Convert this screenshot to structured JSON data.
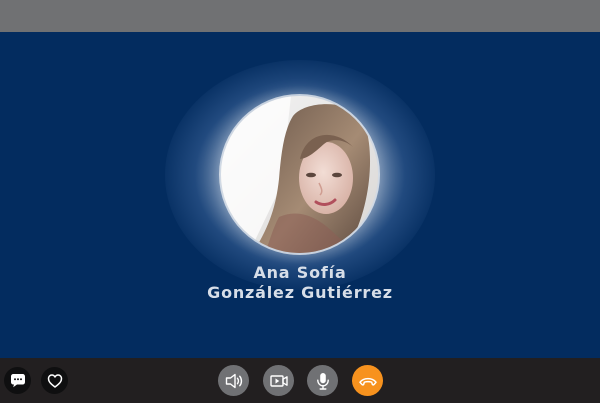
{
  "caller": {
    "name_line1": "Ana Sofía",
    "name_line2": "González Gutiérrez"
  },
  "controls": {
    "left": [
      {
        "name": "chat",
        "icon": "chat-bubble-icon"
      },
      {
        "name": "favorite",
        "icon": "heart-icon"
      }
    ],
    "center": [
      {
        "name": "speaker",
        "icon": "speaker-icon"
      },
      {
        "name": "video",
        "icon": "video-camera-icon"
      },
      {
        "name": "microphone",
        "icon": "microphone-icon"
      },
      {
        "name": "end-call",
        "icon": "phone-hangup-icon"
      }
    ]
  },
  "colors": {
    "background": "#032c5f",
    "top_bar": "#707173",
    "control_bar": "#221f20",
    "control_button": "#707174",
    "end_call": "#f7921e",
    "name_text": "#d7dee8"
  }
}
